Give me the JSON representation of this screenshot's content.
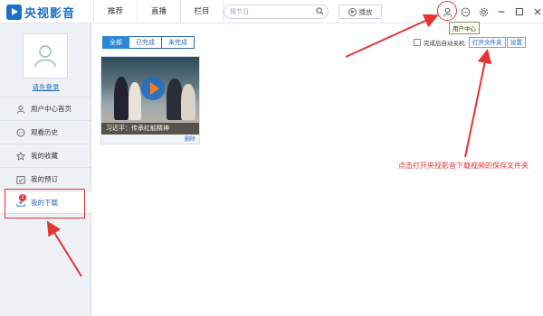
{
  "app": {
    "brand": "央视影音"
  },
  "nav": {
    "items": [
      "推荐",
      "直播",
      "栏目"
    ]
  },
  "search": {
    "placeholder": "搜节目"
  },
  "toolbar": {
    "play_label": "播放",
    "tooltip": "用户中心"
  },
  "sidebar": {
    "login": "请先登录",
    "items": [
      {
        "label": "用户中心首页",
        "icon": "user-icon"
      },
      {
        "label": "观看历史",
        "icon": "history-icon"
      },
      {
        "label": "我的收藏",
        "icon": "star-icon"
      },
      {
        "label": "我的预订",
        "icon": "booking-icon"
      },
      {
        "label": "我的下载",
        "icon": "download-icon",
        "active": true,
        "badge": "1"
      }
    ]
  },
  "filters": {
    "tabs": [
      "全部",
      "已完成",
      "未完成"
    ],
    "active": "全部"
  },
  "actions": {
    "auto_shutdown": "完成后自动关机",
    "open_folder": "打开文件夹",
    "settings": "设置"
  },
  "downloads": [
    {
      "title": "习近平：传承红船精神",
      "delete_label": "删除"
    }
  ],
  "annotation": {
    "text": "点击打开央视影音下载视频的保存文件夹"
  },
  "colors": {
    "accent": "#2a88d8",
    "brand": "#1a6fc9",
    "annotation": "#e53333"
  }
}
